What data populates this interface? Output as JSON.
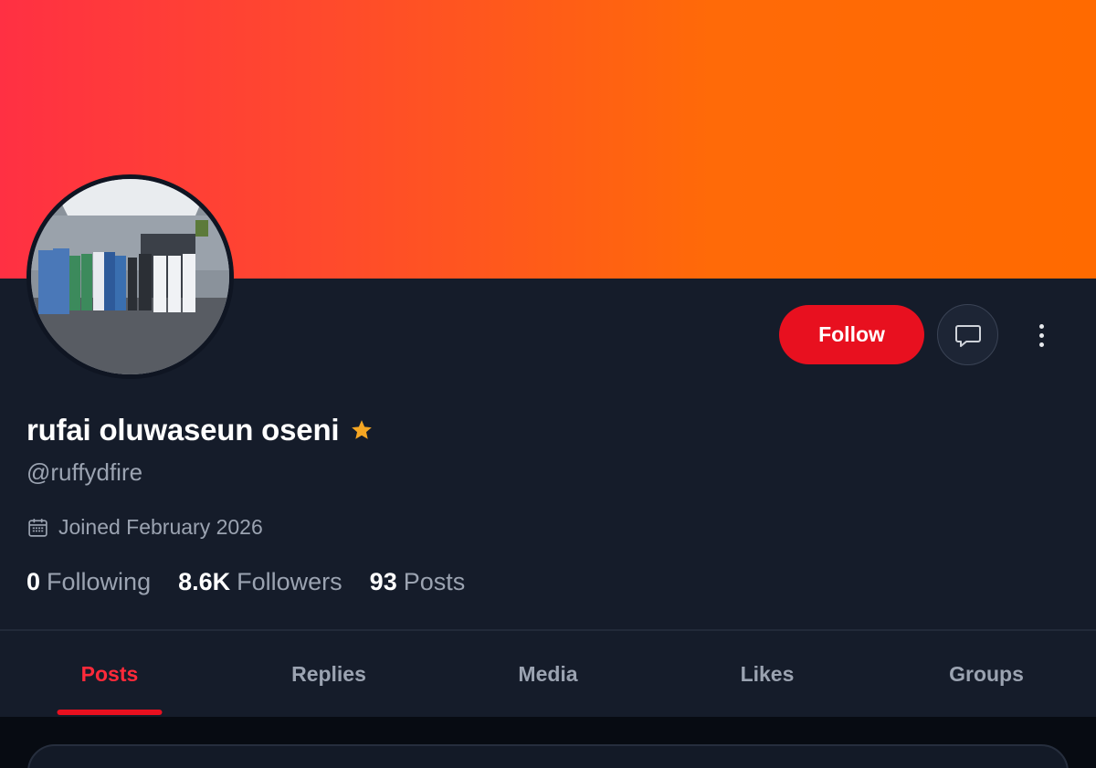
{
  "profile": {
    "name": "rufai oluwaseun oseni",
    "handle": "@ruffydfire",
    "joined": "Joined February 2026",
    "badge_icon": "star-icon"
  },
  "actions": {
    "follow_label": "Follow",
    "message_icon": "chat-bubble-icon",
    "more_icon": "more-vertical-icon"
  },
  "stats": [
    {
      "value": "0",
      "label": "Following"
    },
    {
      "value": "8.6K",
      "label": "Followers"
    },
    {
      "value": "93",
      "label": "Posts"
    }
  ],
  "tabs": [
    {
      "label": "Posts",
      "active": true
    },
    {
      "label": "Replies",
      "active": false
    },
    {
      "label": "Media",
      "active": false
    },
    {
      "label": "Likes",
      "active": false
    },
    {
      "label": "Groups",
      "active": false
    }
  ],
  "colors": {
    "banner_start": "#ff3043",
    "banner_end": "#ff6a00",
    "accent": "#e8101f",
    "background": "#151c2a",
    "badge": "#f5a623"
  }
}
